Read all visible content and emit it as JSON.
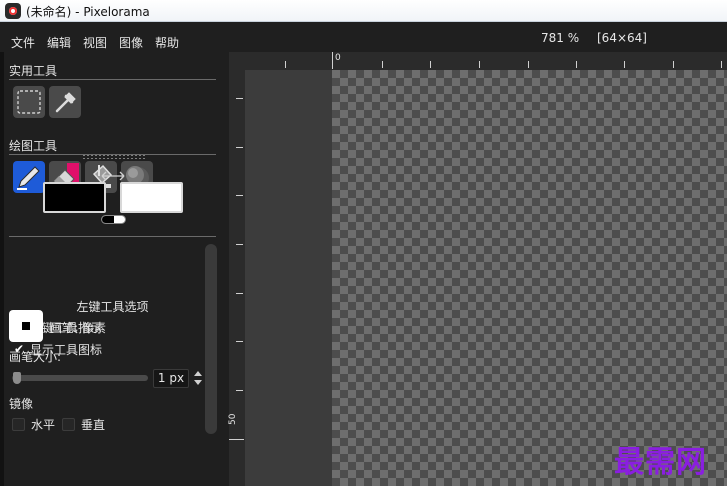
{
  "window": {
    "title": "(未命名) - Pixelorama"
  },
  "menu": {
    "items": [
      "文件",
      "编辑",
      "视图",
      "图像",
      "帮助"
    ],
    "zoom": "781 %",
    "canvas_size": "[64×64]"
  },
  "utility_tools": {
    "label": "实用工具",
    "tools": [
      "rectangle-select-icon",
      "color-picker-icon"
    ]
  },
  "draw_tools": {
    "label": "绘图工具",
    "tools": [
      "pencil-icon",
      "eraser-icon",
      "bucket-icon",
      "shading-icon"
    ]
  },
  "colors": {
    "left": "#000000",
    "right": "#ffffff",
    "accent_blue": "#1e5bd8",
    "accent_pink": "#e0106a"
  },
  "left_tool_options": {
    "title": "左键工具选项",
    "show_indicator_label": "左键工具指示",
    "show_indicator_checked": true,
    "show_icon_label": "显示工具图标",
    "show_icon_checked": true,
    "brush_label": "画笔: 像素",
    "brush_size_label": "画笔大小:",
    "brush_size_value": "1 px",
    "mirror_label": "镜像",
    "mirror_horizontal": "水平",
    "mirror_vertical": "垂直"
  },
  "ruler": {
    "h_label": "0",
    "v_label": "50"
  },
  "watermark": {
    "text": "最需网"
  }
}
